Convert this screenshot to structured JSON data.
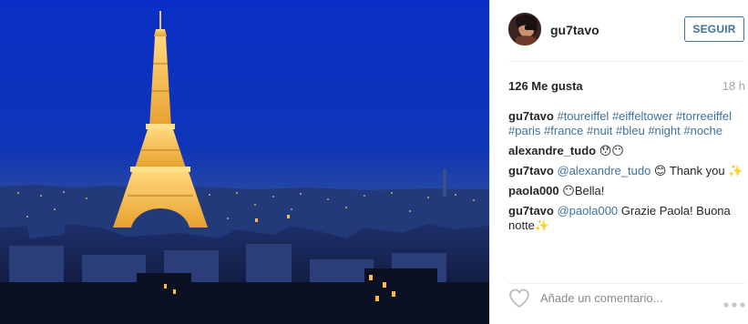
{
  "post": {
    "username": "gu7tavo",
    "follow_label": "SEGUIR",
    "likes": "126 Me gusta",
    "time": "18 h"
  },
  "caption": {
    "user": "gu7tavo",
    "hashtags": [
      "#toureiffel",
      "#eiffeltower",
      "#torreeiffel",
      "#paris",
      "#france",
      "#nuit",
      "#bleu",
      "#night",
      "#noche"
    ]
  },
  "comments": [
    {
      "user": "alexandre_tudo",
      "mention": "",
      "text": "😯😶"
    },
    {
      "user": "gu7tavo",
      "mention": "@alexandre_tudo",
      "text": "😊 Thank you ✨"
    },
    {
      "user": "paola000",
      "mention": "",
      "text": "😶Bella!"
    },
    {
      "user": "gu7tavo",
      "mention": "@paola000",
      "text": "Grazie Paola! Buona notte✨"
    }
  ],
  "footer": {
    "comment_placeholder": "Añade un comentario...",
    "like_icon": "heart-icon",
    "more_icon": "more-options-icon"
  },
  "colors": {
    "link": "#3f729b",
    "sky_top": "#0a2cbf",
    "sky_bottom": "#1a3a8c",
    "tower": "#f0b33a"
  }
}
